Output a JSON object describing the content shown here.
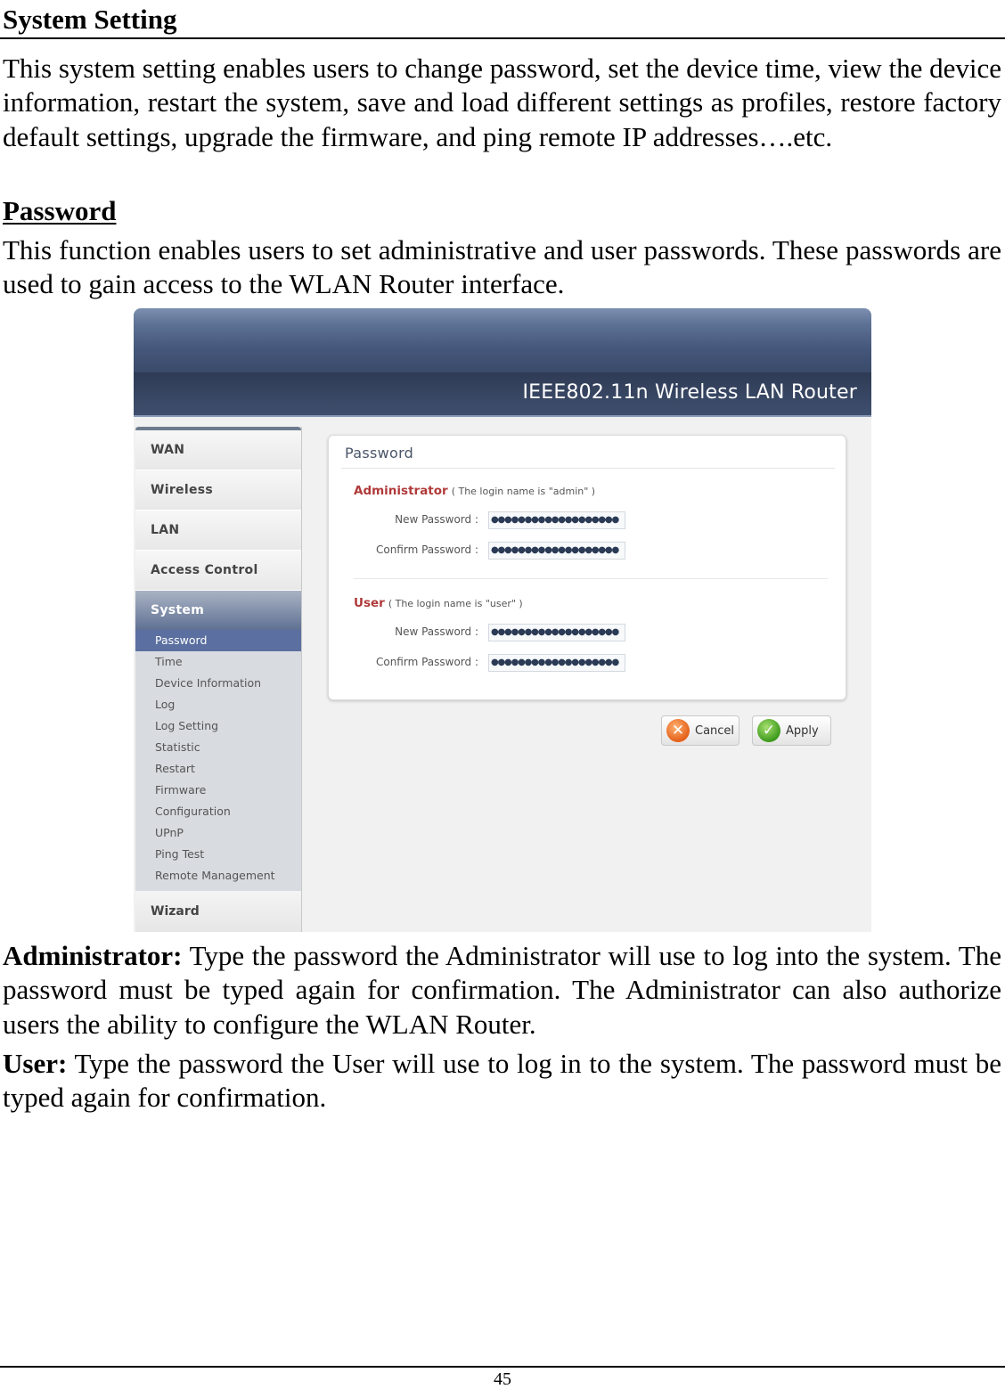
{
  "document": {
    "heading": "System Setting",
    "intro": "This system setting enables users to change password, set the device time, view the device information, restart the system, save and load different settings as profiles, restore factory default settings, upgrade the firmware, and ping remote IP addresses….etc.",
    "subheading": "Password",
    "password_desc": "This function enables users to set administrative and user passwords. These passwords are used to gain access to the WLAN Router interface.",
    "admin_term": "Administrator:",
    "admin_desc": " Type the password the Administrator will use to log into the system. The password must be typed again for confirmation. The Administrator can also authorize users the ability to configure the WLAN Router.",
    "user_term": "User:",
    "user_desc": " Type the password the User will use to log in to the system. The password must be typed again for confirmation.",
    "page_number": "45"
  },
  "router_ui": {
    "banner_title": "IEEE802.11n  Wireless LAN Router",
    "menu": {
      "items": [
        {
          "label": "WAN"
        },
        {
          "label": "Wireless"
        },
        {
          "label": "LAN"
        },
        {
          "label": "Access Control"
        },
        {
          "label": "System",
          "active": true
        }
      ],
      "system_subitems": [
        {
          "label": "Password",
          "active": true
        },
        {
          "label": "Time"
        },
        {
          "label": "Device Information"
        },
        {
          "label": "Log"
        },
        {
          "label": "Log Setting"
        },
        {
          "label": "Statistic"
        },
        {
          "label": "Restart"
        },
        {
          "label": "Firmware"
        },
        {
          "label": "Configuration"
        },
        {
          "label": "UPnP"
        },
        {
          "label": "Ping Test"
        },
        {
          "label": "Remote Management"
        }
      ],
      "wizard": "Wizard"
    },
    "panel": {
      "title": "Password",
      "admin": {
        "title": "Administrator",
        "note": "( The login name is \"admin\" )",
        "new_label": "New Password :",
        "confirm_label": "Confirm Password :",
        "new_value": "●●●●●●●●●●●●●●●●●●●",
        "confirm_value": "●●●●●●●●●●●●●●●●●●●"
      },
      "user": {
        "title": "User",
        "note": "( The login name is \"user\" )",
        "new_label": "New Password :",
        "confirm_label": "Confirm Password :",
        "new_value": "●●●●●●●●●●●●●●●●●●●",
        "confirm_value": "●●●●●●●●●●●●●●●●●●●"
      }
    },
    "buttons": {
      "cancel": "Cancel",
      "apply": "Apply",
      "cancel_icon": "✕",
      "apply_icon": "✓"
    },
    "colors": {
      "section_title": "#b03a3a",
      "menu_active": "#5b70a0",
      "banner": "#3a4a6a"
    }
  }
}
